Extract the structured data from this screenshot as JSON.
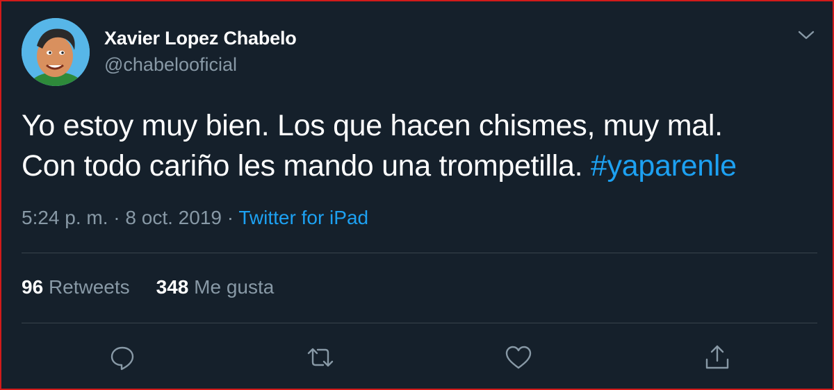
{
  "tweet": {
    "author": {
      "display_name": "Xavier Lopez Chabelo",
      "handle": "@chabelooficial",
      "avatar_icon": "profile-photo"
    },
    "text_lines": [
      "Yo estoy muy bien. Los que hacen chismes, muy mal.",
      "Con todo cariño les mando una trompetilla. "
    ],
    "hashtag": "#yaparenle",
    "meta": {
      "time": "5:24 p. m.",
      "separator": "·",
      "date": "8 oct. 2019",
      "source": "Twitter for iPad"
    },
    "stats": {
      "retweets_count": "96",
      "retweets_label": "Retweets",
      "likes_count": "348",
      "likes_label": "Me gusta"
    },
    "actions": [
      "reply-icon",
      "retweet-icon",
      "like-icon",
      "share-icon"
    ]
  },
  "colors": {
    "background": "#15202b",
    "text": "#ffffff",
    "muted": "#8899a6",
    "link": "#1da1f2",
    "divider": "#38444d",
    "frame_border": "#d11a1a"
  }
}
